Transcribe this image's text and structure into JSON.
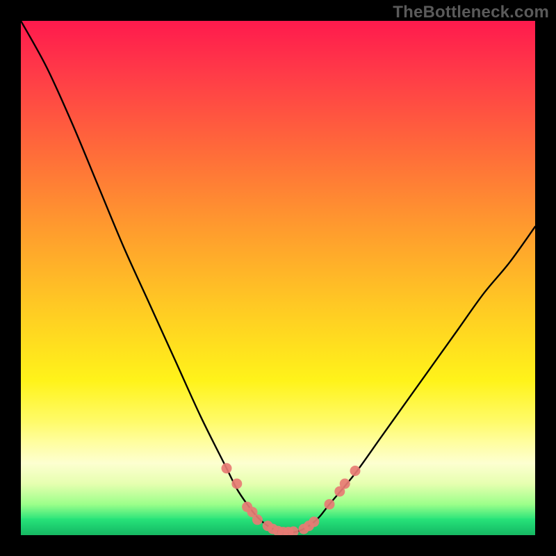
{
  "watermark": "TheBottleneck.com",
  "colors": {
    "frame": "#000000",
    "curve": "#000000",
    "marker": "#e77b74",
    "gradient_top": "#ff1a4d",
    "gradient_bottom": "#1ed877"
  },
  "chart_data": {
    "type": "line",
    "title": "",
    "xlabel": "",
    "ylabel": "",
    "xlim": [
      0,
      100
    ],
    "ylim": [
      0,
      100
    ],
    "x": [
      0,
      5,
      10,
      15,
      20,
      25,
      30,
      35,
      40,
      42,
      44,
      46,
      48,
      50,
      52,
      54,
      56,
      58,
      60,
      65,
      70,
      75,
      80,
      85,
      90,
      95,
      100
    ],
    "y": [
      100,
      91,
      80,
      68,
      56,
      45,
      34,
      23,
      13,
      9,
      6,
      3.5,
      1.8,
      0.8,
      0.5,
      0.8,
      1.8,
      3.5,
      6,
      12,
      19,
      26,
      33,
      40,
      47,
      53,
      60
    ],
    "series": [
      {
        "name": "curve",
        "x": [
          0,
          5,
          10,
          15,
          20,
          25,
          30,
          35,
          40,
          42,
          44,
          46,
          48,
          50,
          52,
          54,
          56,
          58,
          60,
          65,
          70,
          75,
          80,
          85,
          90,
          95,
          100
        ],
        "y": [
          100,
          91,
          80,
          68,
          56,
          45,
          34,
          23,
          13,
          9,
          6,
          3.5,
          1.8,
          0.8,
          0.5,
          0.8,
          1.8,
          3.5,
          6,
          12,
          19,
          26,
          33,
          40,
          47,
          53,
          60
        ]
      }
    ],
    "markers": [
      {
        "x": 40,
        "y": 13
      },
      {
        "x": 42,
        "y": 10
      },
      {
        "x": 44,
        "y": 5.5
      },
      {
        "x": 45,
        "y": 4.5
      },
      {
        "x": 46,
        "y": 3.0
      },
      {
        "x": 48,
        "y": 1.8
      },
      {
        "x": 49,
        "y": 1.2
      },
      {
        "x": 50,
        "y": 0.8
      },
      {
        "x": 51,
        "y": 0.6
      },
      {
        "x": 52,
        "y": 0.6
      },
      {
        "x": 53,
        "y": 0.7
      },
      {
        "x": 55,
        "y": 1.2
      },
      {
        "x": 56,
        "y": 1.8
      },
      {
        "x": 57,
        "y": 2.6
      },
      {
        "x": 60,
        "y": 6
      },
      {
        "x": 62,
        "y": 8.5
      },
      {
        "x": 63,
        "y": 10
      },
      {
        "x": 65,
        "y": 12.5
      }
    ],
    "annotations": []
  }
}
